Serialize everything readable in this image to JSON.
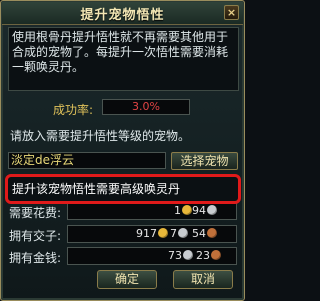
{
  "window": {
    "title": "提升宠物悟性",
    "close_label": "×"
  },
  "description": "使用根骨丹提升悟性就不再需要其他用于合成的宠物了。每提升一次悟性需要消耗一颗唤灵丹。",
  "success_rate": {
    "label": "成功率:",
    "value": "3.0%"
  },
  "hint": "请放入需要提升悟性等级的宠物。",
  "pet": {
    "name": "淡定de浮云",
    "select_button": "选择宠物"
  },
  "tip": "提升该宠物悟性需要高级唤灵丹",
  "cost": {
    "label": "需要花费:",
    "gold": "1",
    "silver": "94",
    "copper": ""
  },
  "owned_jiaozi": {
    "label": "拥有交子:",
    "gold": "917",
    "silver": "7",
    "copper": "54"
  },
  "owned_money": {
    "label": "拥有金钱:",
    "gold": "",
    "silver": "73",
    "copper": "23"
  },
  "buttons": {
    "confirm": "确定",
    "cancel": "取消"
  },
  "colors": {
    "gold_coin": "#e8b83a",
    "silver_coin": "#c8ccd0",
    "copper_coin": "#c0703a",
    "rate_value": "#e24444",
    "tip_border": "#e01a1a"
  }
}
